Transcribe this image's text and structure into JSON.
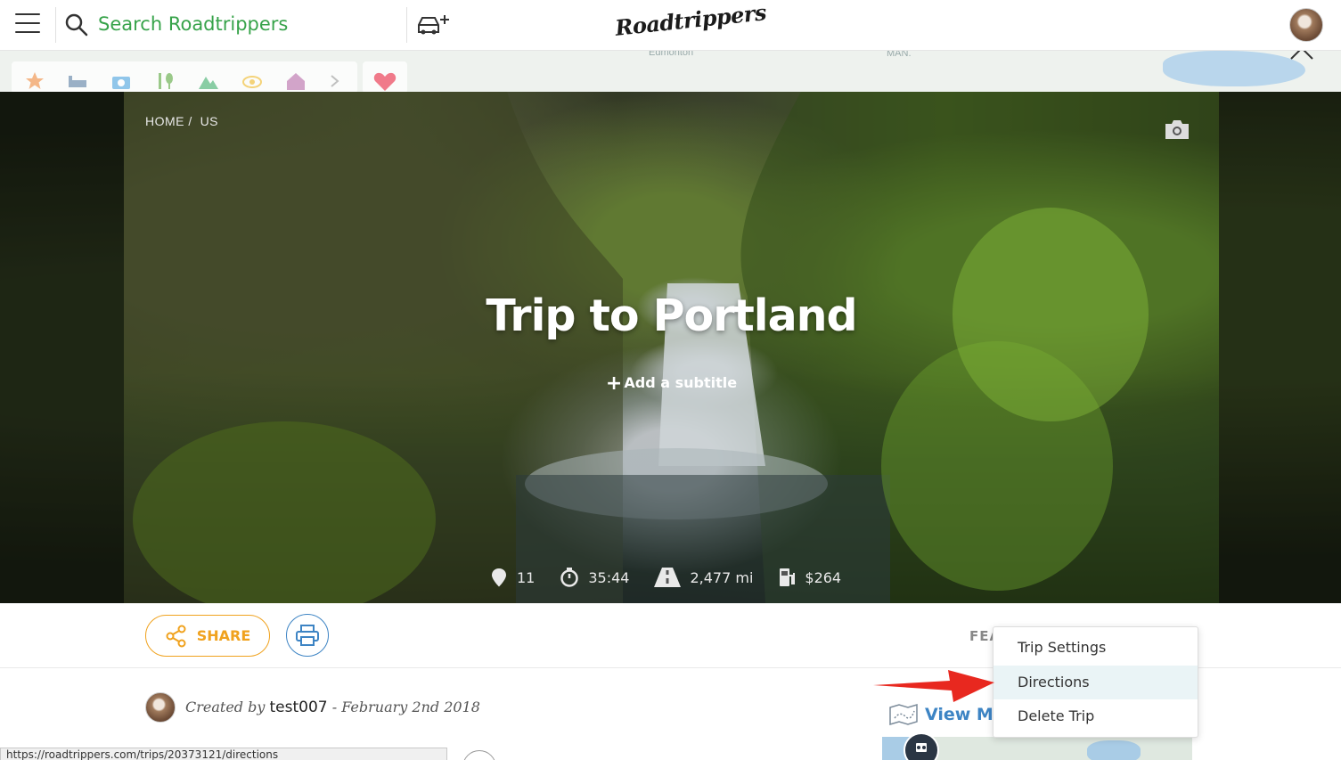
{
  "header": {
    "search_placeholder": "Search Roadtrippers",
    "logo_text": "Roadtrippers"
  },
  "map": {
    "labels": [
      "Edmonton",
      "MAN."
    ]
  },
  "hero": {
    "breadcrumb": [
      "HOME",
      "US"
    ],
    "title": "Trip to Portland",
    "add_subtitle": "Add a subtitle",
    "stats": {
      "stops": "11",
      "duration": "35:44",
      "distance": "2,477 mi",
      "fuel_cost": "$264"
    }
  },
  "actions": {
    "share_label": "SHARE",
    "features_tab": "FEA"
  },
  "creator": {
    "prefix": "Created by",
    "username": "test007",
    "date": "- February 2nd 2018"
  },
  "view_map_label": "View Ma",
  "menu": {
    "items": [
      "Trip Settings",
      "Directions",
      "Delete Trip"
    ],
    "active_index": 1
  },
  "status_url": "https://roadtrippers.com/trips/20373121/directions",
  "colors": {
    "brand_green": "#37a34a",
    "share_orange": "#f0a21e",
    "accent_blue": "#3d84c4",
    "arrow_red": "#e8281f"
  }
}
